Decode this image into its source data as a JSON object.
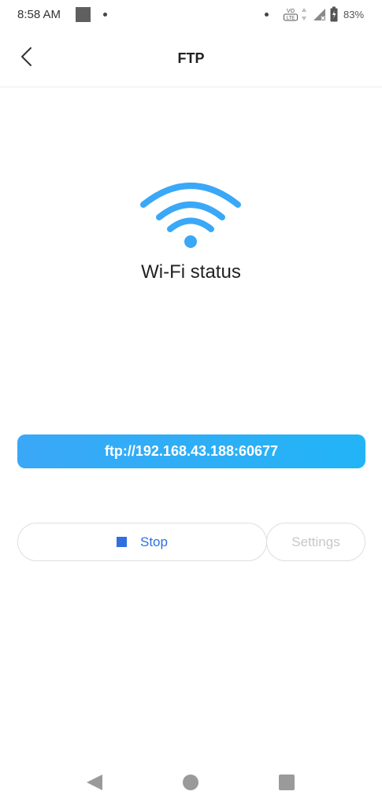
{
  "status_bar": {
    "time": "8:58 AM",
    "volte_label": "VO LTE",
    "battery_percent": "83%",
    "icons": [
      "notification-square-icon",
      "dot-icon",
      "volte-icon",
      "data-arrows-icon",
      "signal-icon",
      "battery-icon"
    ]
  },
  "header": {
    "title": "FTP",
    "back_icon": "chevron-left-icon"
  },
  "wifi": {
    "icon": "wifi-icon",
    "label": "Wi-Fi status",
    "color": "#3aa8f7"
  },
  "ftp": {
    "address": "ftp://192.168.43.188:60677"
  },
  "actions": {
    "stop_label": "Stop",
    "stop_icon": "stop-square-icon",
    "settings_label": "Settings",
    "accent_color": "#2f6fe0"
  },
  "nav_bar": {
    "icons": [
      "nav-back-icon",
      "nav-home-icon",
      "nav-recents-icon"
    ]
  }
}
